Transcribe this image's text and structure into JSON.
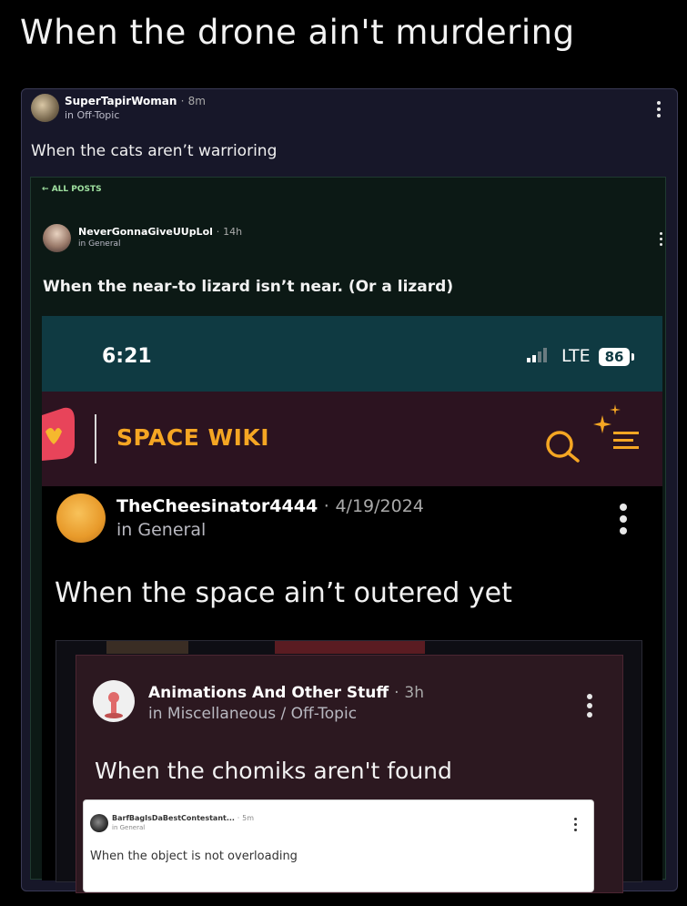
{
  "meme_title": "When the drone ain't murdering",
  "post1": {
    "username": "SuperTapirWoman",
    "time": "8m",
    "community": "in Off-Topic",
    "text": "When the cats aren’t warrioring"
  },
  "post2": {
    "back_link": "ALL POSTS",
    "username": "NeverGonnaGiveUUpLol",
    "time": "14h",
    "community": "in General",
    "text": "When the near-to lizard isn’t near. (Or a lizard)"
  },
  "phone": {
    "time": "6:21",
    "network": "LTE",
    "battery": "86",
    "app_title": "SPACE WIKI"
  },
  "post3": {
    "username": "TheCheesinator4444",
    "date": "4/19/2024",
    "community": "in General",
    "text": "When the space ain’t outered yet"
  },
  "post4": {
    "username": "Animations And Other Stuff",
    "time": "3h",
    "community": "in Miscellaneous / Off-Topic",
    "text": "When the chomiks aren't found"
  },
  "post5": {
    "username": "BarfBagIsDaBestContestant...",
    "time": "5m",
    "community": "in General",
    "text": "When the object is not overloading"
  },
  "separator": "·",
  "colors": {
    "app_accent": "#f5a623",
    "app_bar": "#2c1320",
    "status_bar": "#0f3a42"
  }
}
